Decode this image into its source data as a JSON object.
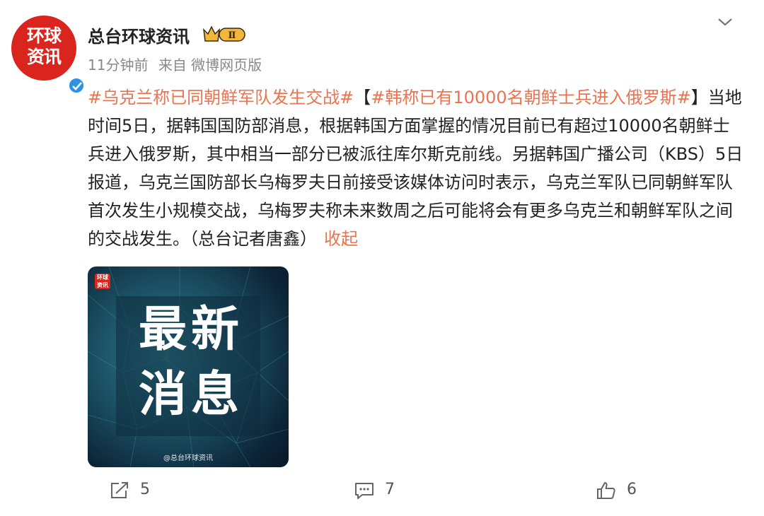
{
  "post": {
    "avatar_text": "环球资讯",
    "author": "总台环球资讯",
    "badge_label": "Ⅱ",
    "time": "11分钟前",
    "source": "来自 微博网页版",
    "tag1": "#乌克兰称已同朝鲜军队发生交战#",
    "bracket_open": "【",
    "tag2": "#韩称已有10000名朝鲜士兵进入俄罗斯#",
    "bracket_close": "】",
    "body": "当地时间5日，据韩国国防部消息，根据韩国方面掌握的情况目前已有超过10000名朝鲜士兵进入俄罗斯，其中相当一部分已被派往库尔斯克前线。另据韩国广播公司（KBS）5日报道，乌克兰国防部长乌梅罗夫日前接受该媒体访问时表示，乌克兰军队已同朝鲜军队首次发生小规模交战，乌梅罗夫称未来数周之后可能将会有更多乌克兰和朝鲜军队之间的交战发生。（总台记者唐鑫）",
    "fold_label": "收起"
  },
  "image": {
    "title": "最新消息",
    "logo_text": "环球资讯",
    "watermark": "@总台环球资讯"
  },
  "actions": {
    "repost_count": "5",
    "comment_count": "7",
    "like_count": "6"
  },
  "colors": {
    "accent": "#eb7350",
    "avatar_red": "#d9251d",
    "verified_blue": "#2a93e6"
  },
  "icons": [
    "chevron-down-icon",
    "verified-icon",
    "crown-badge-icon",
    "repost-icon",
    "comment-icon",
    "like-icon"
  ]
}
